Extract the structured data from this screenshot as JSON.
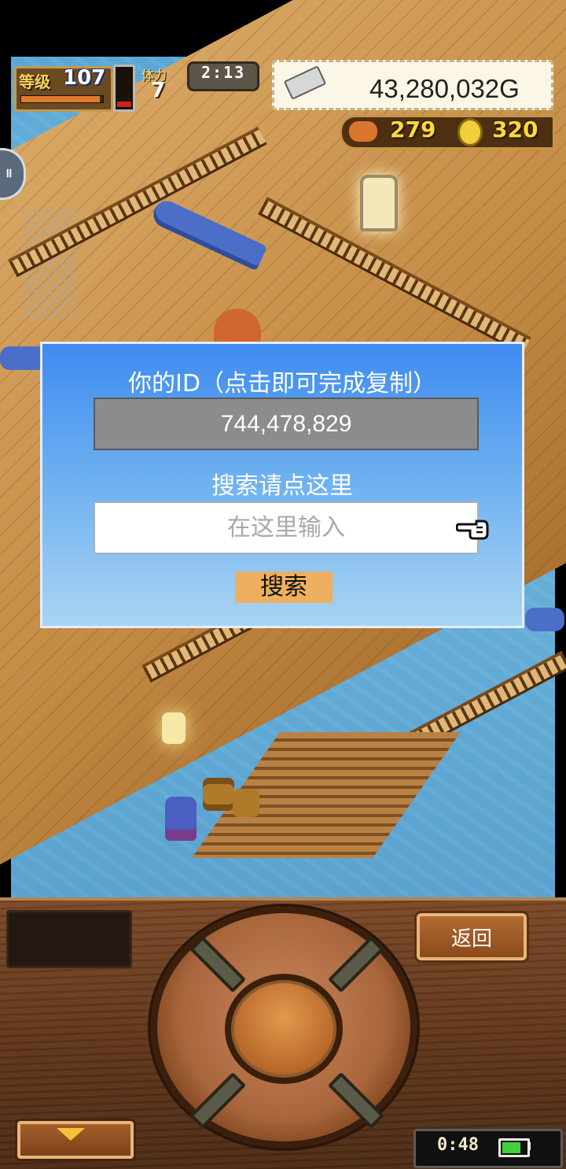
{
  "hud": {
    "level_label": "等级",
    "level": "107",
    "exp_fraction": 0.98,
    "stamina_label": "体力",
    "stamina_value": "7",
    "stamina_fraction": 0.15,
    "timer": "2:13",
    "gold": "43,280,032G",
    "meat": "279",
    "coins": "320"
  },
  "dialog": {
    "id_title": "你的ID（点击即可完成复制）",
    "id_value": "744,478,829",
    "search_title": "搜索请点这里",
    "search_placeholder": "在这里输入",
    "search_value": "",
    "search_button": "搜索"
  },
  "controls": {
    "back_button": "返回",
    "clock": "0:48",
    "battery_fraction": 0.75
  },
  "icons": {
    "gold": "silver-bar-icon",
    "meat": "meat-icon",
    "coin": "coin-icon",
    "hand": "pointing-hand-icon",
    "menu": "triangle-down-icon",
    "battery": "battery-icon"
  },
  "colors": {
    "dialog_top": "#3f8bf0",
    "dialog_bottom": "#a9d4f3",
    "search_button": "#eeb060",
    "resource_text": "#ffd83a"
  }
}
